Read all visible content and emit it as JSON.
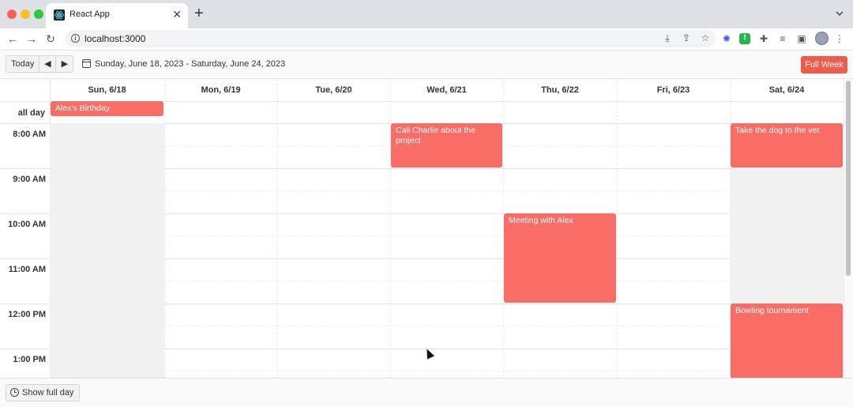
{
  "browser": {
    "tab_title": "React App",
    "tab_close": "✕",
    "new_tab": "+",
    "url": "localhost:3000",
    "nav_back": "←",
    "nav_forward": "→",
    "nav_reload": "↻"
  },
  "header": {
    "today_label": "Today",
    "prev_label": "◀",
    "next_label": "▶",
    "date_range": "Sunday, June 18, 2023 - Saturday, June 24, 2023",
    "full_week_label": "Full Week"
  },
  "calendar": {
    "all_day_label": "all day",
    "days": [
      "Sun, 6/18",
      "Mon, 6/19",
      "Tue, 6/20",
      "Wed, 6/21",
      "Thu, 6/22",
      "Fri, 6/23",
      "Sat, 6/24"
    ],
    "times": [
      "8:00 AM",
      "9:00 AM",
      "10:00 AM",
      "11:00 AM",
      "12:00 PM",
      "1:00 PM"
    ],
    "events": [
      {
        "title": "Alex's Birthday",
        "day": 0,
        "all_day": true
      },
      {
        "title": "Call Charlie about the project",
        "day": 3,
        "start": 8,
        "end": 9
      },
      {
        "title": "Take the dog to the vet",
        "day": 6,
        "start": 8,
        "end": 9
      },
      {
        "title": "Meeting with Alex",
        "day": 4,
        "start": 10,
        "end": 12
      },
      {
        "title": "Bowling tournament",
        "day": 6,
        "start": 12,
        "end": 14
      }
    ],
    "event_color": "#f86d66"
  },
  "footer": {
    "show_full_day_label": "Show full day"
  },
  "colors": {
    "accent": "#f25a4a"
  }
}
